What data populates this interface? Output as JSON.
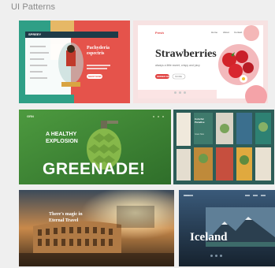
{
  "section_title": "UI Patterns",
  "tiles": {
    "t1": {
      "logo": "SPREEY",
      "heading": "Pachyderia espectris",
      "button": "SHOP NOW"
    },
    "t2": {
      "logo": "Fresh",
      "nav": [
        "Home",
        "About",
        "Contact"
      ],
      "heading": "Strawberries",
      "subheading": "always a little sweet, crispy and juicy",
      "button": "ORDER NOW",
      "button2": "MORE"
    },
    "t3": {
      "logo": "GRN",
      "heading_line1": "A HEALTHY",
      "heading_line2": "EXPLOSION",
      "big": "GREENADE!"
    },
    "t4": {
      "heading": "Colorful Paradise",
      "subheading": "Greet Now"
    },
    "t5": {
      "heading_line1": "There's magic in",
      "heading_line2": "Eternal Travel"
    },
    "t6": {
      "logo": "TRVL",
      "heading": "Iceland"
    }
  }
}
